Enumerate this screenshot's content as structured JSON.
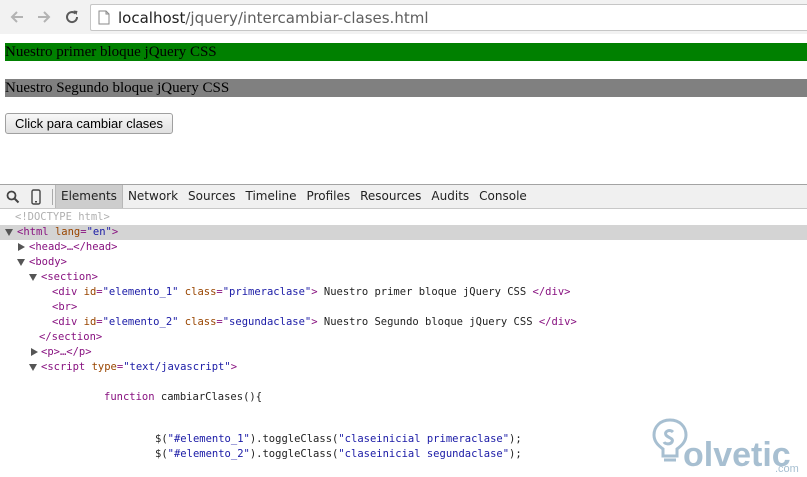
{
  "browser": {
    "url_host": "localhost",
    "url_path": "/jquery/intercambiar-clases.html",
    "icons": [
      "back-arrow-icon",
      "forward-arrow-icon",
      "reload-icon",
      "page-icon"
    ]
  },
  "page": {
    "bloque_1": "Nuestro primer bloque jQuery CSS",
    "bloque_2": "Nuestro Segundo bloque jQuery CSS",
    "button_label": "Click para cambiar clases",
    "colors": {
      "primeraclase": "#008000",
      "segundaclase": "#808080"
    }
  },
  "devtools": {
    "icons": [
      "search-icon",
      "mobile-device-icon"
    ],
    "tabs": [
      "Elements",
      "Network",
      "Sources",
      "Timeline",
      "Profiles",
      "Resources",
      "Audits",
      "Console"
    ],
    "active_tab": "Elements",
    "dom": {
      "doctype": "<!DOCTYPE html>",
      "html_open": "<html",
      "html_attr": "lang",
      "html_val": "\"en\"",
      "head": "<head>…</head>",
      "body_open": "<body>",
      "section_open": "<section>",
      "div1_tag": "<div",
      "div1_id_attr": "id",
      "div1_id_val": "\"elemento_1\"",
      "div1_class_attr": "class",
      "div1_class_val": "\"primeraclase\"",
      "div1_text": " Nuestro primer bloque jQuery CSS",
      "div_close": "</div>",
      "br": "<br>",
      "div2_tag": "<div",
      "div2_id_attr": "id",
      "div2_id_val": "\"elemento_2\"",
      "div2_class_attr": "class",
      "div2_class_val": "\"segundaclase\"",
      "div2_text": " Nuestro Segundo bloque jQuery CSS",
      "section_close": "</section>",
      "p": "<p>…</p>",
      "script_tag": "<script",
      "script_attr": "type",
      "script_val": "\"text/javascript\"",
      "code_function": "function",
      "code_fn_name": " cambiarClases(){",
      "code_line1_a": "$(",
      "code_line1_sel": "\"#elemento_1\"",
      "code_line1_b": ").toggleClass(",
      "code_line1_arg": "\"claseinicial primeraclase\"",
      "code_line1_c": ");",
      "code_line2_a": "$(",
      "code_line2_sel": "\"#elemento_2\"",
      "code_line2_b": ").toggleClass(",
      "code_line2_arg": "\"claseinicial segundaclase\"",
      "code_line2_c": ");"
    }
  },
  "watermark": {
    "brand": "olvetic",
    "domain": ".com",
    "logo_icon": "solvetic-logo-icon"
  }
}
